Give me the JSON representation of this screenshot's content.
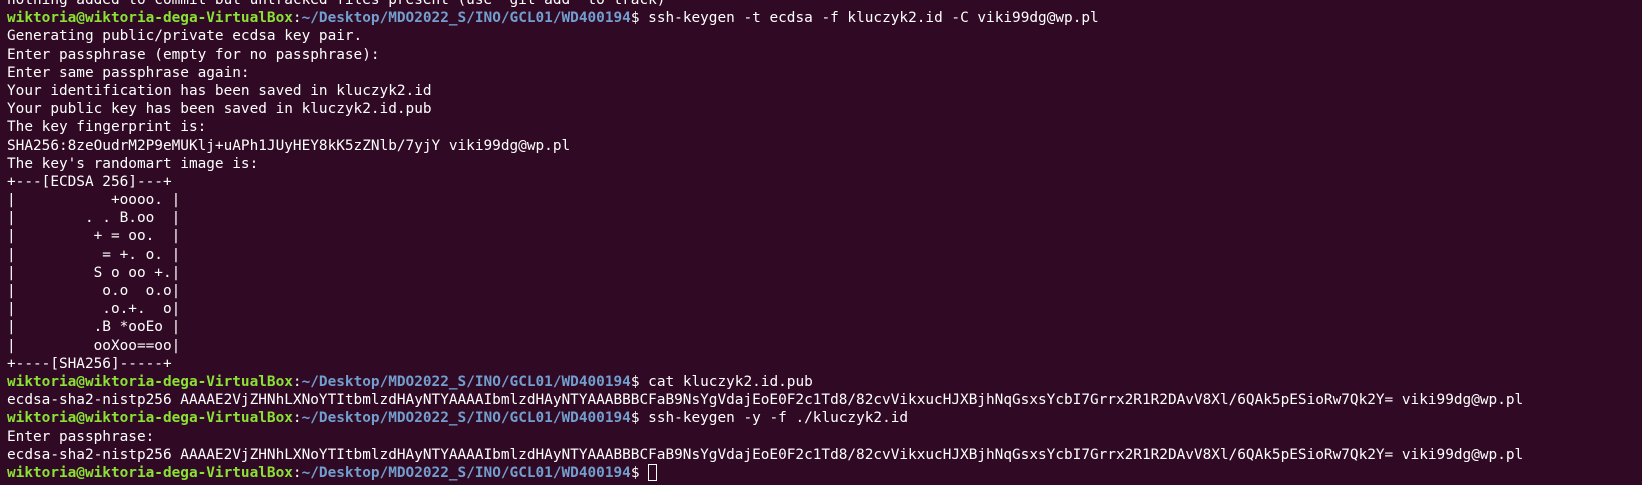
{
  "terminal": {
    "prompt": {
      "user_host": "wiktoria@wiktoria-dega-VirtualBox",
      "colon": ":",
      "path": "~/Desktop/MDO2022_S/INO/GCL01/WD400194",
      "symbol": "$"
    },
    "lines": [
      "nothing added to commit but untracked files present (use \"git add\" to track)",
      {
        "command": " ssh-keygen -t ecdsa -f kluczyk2.id -C viki99dg@wp.pl"
      },
      "Generating public/private ecdsa key pair.",
      "Enter passphrase (empty for no passphrase):",
      "Enter same passphrase again:",
      "Your identification has been saved in kluczyk2.id",
      "Your public key has been saved in kluczyk2.id.pub",
      "The key fingerprint is:",
      "SHA256:8zeOudrM2P9eMUKlj+uAPh1JUyHEY8kK5zZNlb/7yjY viki99dg@wp.pl",
      "The key's randomart image is:",
      "+---[ECDSA 256]---+",
      "|           +oooo. |",
      "|        . . B.oo  |",
      "|         + = oo.  |",
      "|          = +. o. |",
      "|         S o oo +.|",
      "|          o.o  o.o|",
      "|          .o.+.  o|",
      "|         .B *ooEo |",
      "|         ooXoo==oo|",
      "+----[SHA256]-----+",
      {
        "command": " cat kluczyk2.id.pub"
      },
      "ecdsa-sha2-nistp256 AAAAE2VjZHNhLXNoYTItbmlzdHAyNTYAAAAIbmlzdHAyNTYAAABBBCFaB9NsYgVdajEoE0F2c1Td8/82cvVikxucHJXBjhNqGsxsYcbI7Grrx2R1R2DAvV8Xl/6QAk5pESioRw7Qk2Y= viki99dg@wp.pl",
      {
        "command": " ssh-keygen -y -f ./kluczyk2.id"
      },
      "Enter passphrase:",
      "ecdsa-sha2-nistp256 AAAAE2VjZHNhLXNoYTItbmlzdHAyNTYAAAAIbmlzdHAyNTYAAABBBCFaB9NsYgVdajEoE0F2c1Td8/82cvVikxucHJXBjhNqGsxsYcbI7Grrx2R1R2DAvV8Xl/6QAk5pESioRw7Qk2Y= viki99dg@wp.pl",
      {
        "command": "",
        "cursor": true
      }
    ]
  },
  "colors": {
    "background": "#300a24",
    "text": "#ffffff",
    "prompt_user": "#8ae234",
    "prompt_path": "#729fcf"
  }
}
